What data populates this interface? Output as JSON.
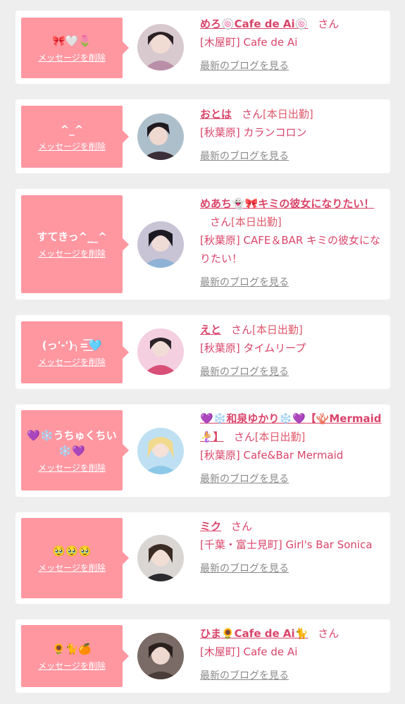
{
  "delete_label": "メッセージを削除",
  "blog_label": "最新のブログを見る",
  "san_label": "さん",
  "colors": {
    "bubble": "#ff97a1",
    "name": "#d9456a",
    "link_gray": "#8a8a8a"
  },
  "cards": [
    {
      "message": "🎀🤍🌷",
      "name": "めろ🍥Cafe de Ai🍥",
      "status": "",
      "shop": "[木屋町] Cafe de Ai"
    },
    {
      "message": "^_^",
      "name": "おとは",
      "status": "[本日出勤]",
      "shop": "[秋葉原] カランコロン"
    },
    {
      "message": "すてきっ^_̮_^",
      "name": "めあち👻🎀キミの彼女になりたい！",
      "status": "[本日出勤]",
      "shop": "[秋葉原] CAFE＆BAR キミの彼女になりたい！"
    },
    {
      "message": "(っ'-')╮=͟͟͞͞🩵",
      "name": "えと",
      "status": "[本日出勤]",
      "shop": "[秋葉原] タイムリープ"
    },
    {
      "message": "💜❄️うちゅくちい❄️💜",
      "name": "💜❄️和泉ゆかり❄️💜【🪸Mermaid🧜‍♀️】",
      "status": "[本日出勤]",
      "shop": "[秋葉原] Cafe&Bar Mermaid"
    },
    {
      "message": "🥹🥹🥹",
      "name": "ミク",
      "status": "",
      "shop": "[千葉・富士見町] Girl's Bar Sonica"
    },
    {
      "message": "🌻🐈🍊",
      "name": "ひま🌻Cafe de Ai🐈",
      "status": "",
      "shop": "[木屋町] Cafe de Ai"
    }
  ]
}
